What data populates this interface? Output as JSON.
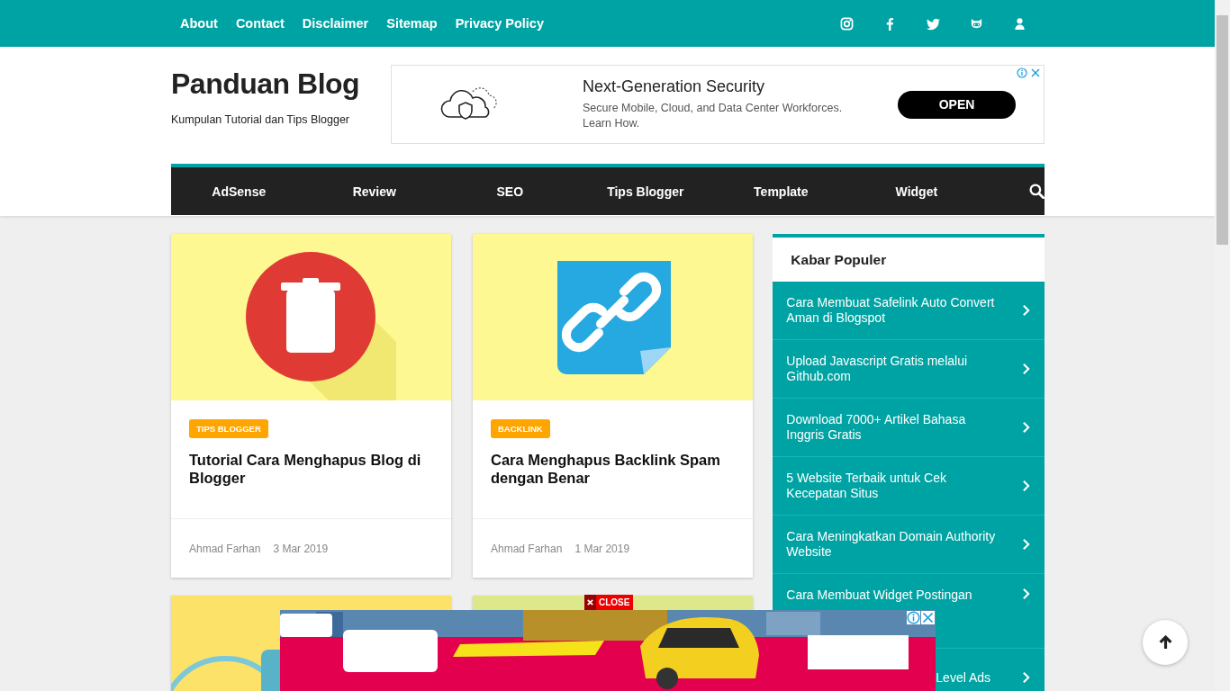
{
  "top_links": [
    "About",
    "Contact",
    "Disclaimer",
    "Sitemap",
    "Privacy Policy"
  ],
  "social": [
    {
      "kind": "instagram"
    },
    {
      "kind": "facebook"
    },
    {
      "kind": "twitter"
    },
    {
      "kind": "github"
    },
    {
      "kind": "user"
    }
  ],
  "site": {
    "title": "Panduan Blog",
    "tagline": "Kumpulan Tutorial dan Tips Blogger"
  },
  "header_ad": {
    "title": "Next-Generation Security",
    "text": "Secure Mobile, Cloud, and Data Center Workforces. Learn How.",
    "button": "OPEN"
  },
  "nav": [
    "AdSense",
    "Review",
    "SEO",
    "Tips Blogger",
    "Template",
    "Widget"
  ],
  "posts": [
    {
      "kind": "post",
      "tag": "TIPS BLOGGER",
      "title": "Tutorial Cara Menghapus Blog di Blogger",
      "author": "Ahmad Farhan",
      "date": "3 Mar 2019"
    },
    {
      "kind": "post",
      "tag": "BACKLINK",
      "title": "Cara Menghapus Backlink Spam dengan Benar",
      "author": "Ahmad Farhan",
      "date": "1 Mar 2019"
    },
    {
      "kind": "picture"
    },
    {
      "kind": "picture"
    }
  ],
  "sidebar": {
    "title": "Kabar Populer",
    "items": [
      {
        "kind": "full",
        "text": "Cara Membuat Safelink Auto Convert Aman di Blogspot"
      },
      {
        "kind": "full",
        "text": "Upload Javascript Gratis melalui Github.com"
      },
      {
        "kind": "full",
        "text": "Download 7000+ Artikel Bahasa Inggris Gratis"
      },
      {
        "kind": "full",
        "text": "5 Website Terbaik untuk Cek Kecepatan Situs"
      },
      {
        "kind": "full",
        "text": "Cara Meningkatkan Domain Authority Website"
      },
      {
        "kind": "tall",
        "text": "Cara Membuat Widget Postingan"
      },
      {
        "kind": "covered",
        "text": "Level Ads"
      }
    ]
  },
  "bottom_ad": {
    "close": "CLOSE"
  }
}
